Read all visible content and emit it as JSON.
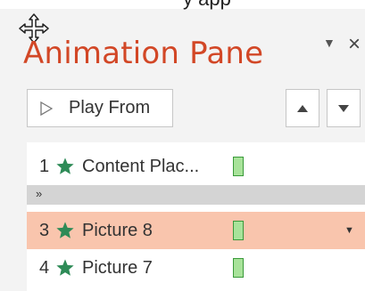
{
  "window": {
    "top_text": "y app"
  },
  "pane": {
    "title": "Animation Pane",
    "title_color": "#d24726",
    "play_from_label": "Play From"
  },
  "rows": [
    {
      "number": "1",
      "name": "Content Plac...",
      "icon": "star-icon",
      "selected": false
    },
    {
      "number": "3",
      "name": "Picture 8",
      "icon": "star-icon",
      "selected": true
    },
    {
      "number": "4",
      "name": "Picture 7",
      "icon": "star-icon",
      "selected": false
    }
  ],
  "colors": {
    "star": "#2e8b57",
    "timing_fill": "#a8e39a",
    "timing_border": "#3a9a3a",
    "selected_row": "#f9c5ad",
    "separator": "#d4d4d4"
  }
}
